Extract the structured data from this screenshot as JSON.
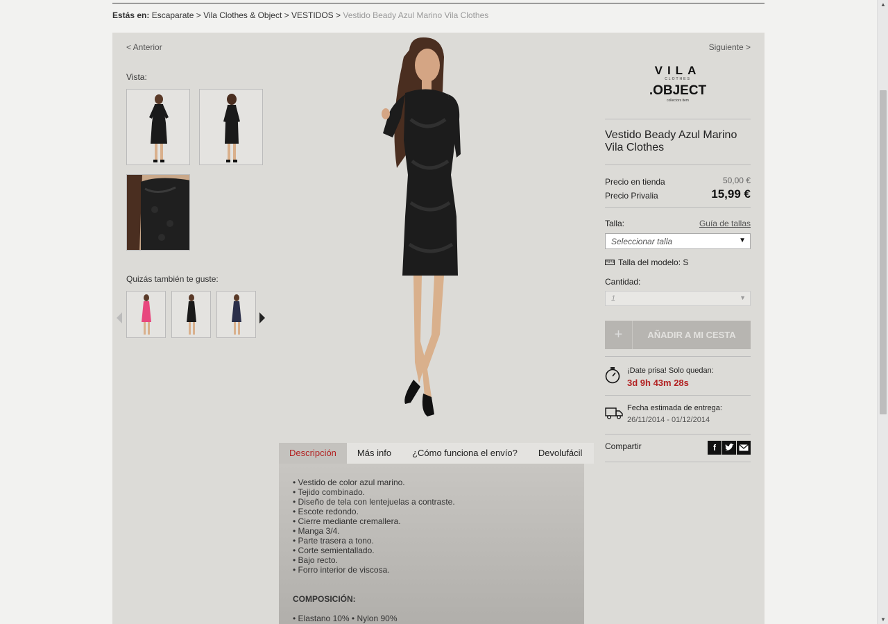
{
  "breadcrumb": {
    "prefix": "Estás en:",
    "items": [
      "Escaparate",
      "Vila Clothes & Object",
      "VESTIDOS"
    ],
    "separator": ">",
    "current": "Vestido Beady Azul Marino Vila Clothes"
  },
  "nav": {
    "prev": "< Anterior",
    "next": "Siguiente >"
  },
  "gallery": {
    "label": "Vista:"
  },
  "related": {
    "label": "Quizás también te guste:"
  },
  "brand": {
    "line1": "VILA",
    "line1_sub": "CLOTHES",
    "line2": ".OBJECT",
    "line2_sub": "collectors item"
  },
  "product": {
    "name": "Vestido Beady Azul Marino Vila Clothes",
    "store_price_label": "Precio en tienda",
    "store_price": "50,00 €",
    "privalia_price_label": "Precio Privalia",
    "privalia_price": "15,99 €"
  },
  "size": {
    "label": "Talla:",
    "guide_link": "Guía de tallas",
    "placeholder": "Seleccionar talla",
    "model_size": "Talla del modelo: S"
  },
  "quantity": {
    "label": "Cantidad:",
    "value": "1"
  },
  "cart": {
    "plus": "+",
    "label": "AÑADIR A MI CESTA"
  },
  "timer": {
    "label": "¡Date prisa! Solo quedan:",
    "value": "3d 9h 43m 28s"
  },
  "delivery": {
    "label": "Fecha estimada de entrega:",
    "dates": "26/11/2014 - 01/12/2014"
  },
  "share": {
    "label": "Compartir",
    "icons": [
      "facebook-icon",
      "twitter-icon",
      "mail-icon"
    ]
  },
  "tabs": [
    "Descripción",
    "Más info",
    "¿Cómo funciona el envío?",
    "Devolufácil"
  ],
  "description": {
    "bullets": [
      "• Vestido de color azul marino.",
      "• Tejido combinado.",
      "• Diseño de tela con lentejuelas a contraste.",
      "• Escote redondo.",
      "• Cierre mediante cremallera.",
      "• Manga 3/4.",
      "• Parte trasera a tono.",
      "• Corte semientallado.",
      "• Bajo recto.",
      "• Forro interior de viscosa."
    ],
    "composition_title": "COMPOSICIÓN:",
    "composition": "• Elastano 10% • Nylon 90%"
  },
  "colors": {
    "accent": "#b22222",
    "panel": "#dcdbd7",
    "button": "#b7b5b1"
  }
}
